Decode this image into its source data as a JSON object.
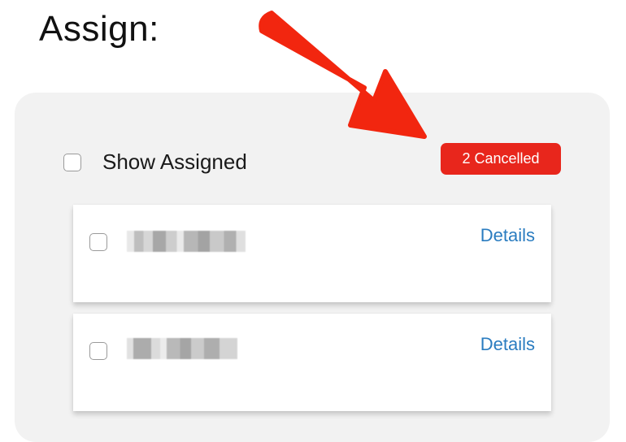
{
  "page": {
    "title": "Assign:"
  },
  "filters": {
    "show_assigned_label": "Show Assigned",
    "show_assigned_checked": false
  },
  "badge": {
    "label": "2 Cancelled",
    "color": "#e8261c"
  },
  "items": [
    {
      "details_label": "Details",
      "checked": false,
      "name_redacted": true
    },
    {
      "details_label": "Details",
      "checked": false,
      "name_redacted": true
    }
  ],
  "colors": {
    "panel_background": "#f2f2f2",
    "link": "#2a7cc0",
    "annotation_arrow": "#f2260f"
  }
}
